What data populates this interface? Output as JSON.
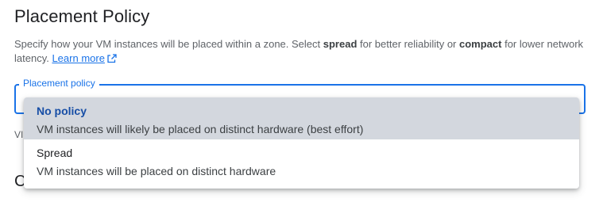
{
  "section": {
    "title": "Placement Policy",
    "description_part1": "Specify how your VM instances will be placed within a zone. Select ",
    "description_spread": "spread",
    "description_part2": " for better reliability or ",
    "description_compact": "compact",
    "description_part3": " for lower network latency. ",
    "learn_more_label": "Learn more",
    "learn_more_icon": "external-link-icon"
  },
  "field": {
    "label": "Placement policy",
    "hint_below_prefix": "VI"
  },
  "dropdown": {
    "options": [
      {
        "title": "No policy",
        "description": "VM instances will likely be placed on distinct hardware (best effort)",
        "selected": true
      },
      {
        "title": "Spread",
        "description": "VM instances will be placed on distinct hardware",
        "selected": false
      }
    ]
  },
  "next_section": {
    "heading_prefix": "C"
  },
  "colors": {
    "accent": "#1a73e8",
    "selected_bg": "#d3d7de",
    "selected_text": "#174ea6"
  }
}
